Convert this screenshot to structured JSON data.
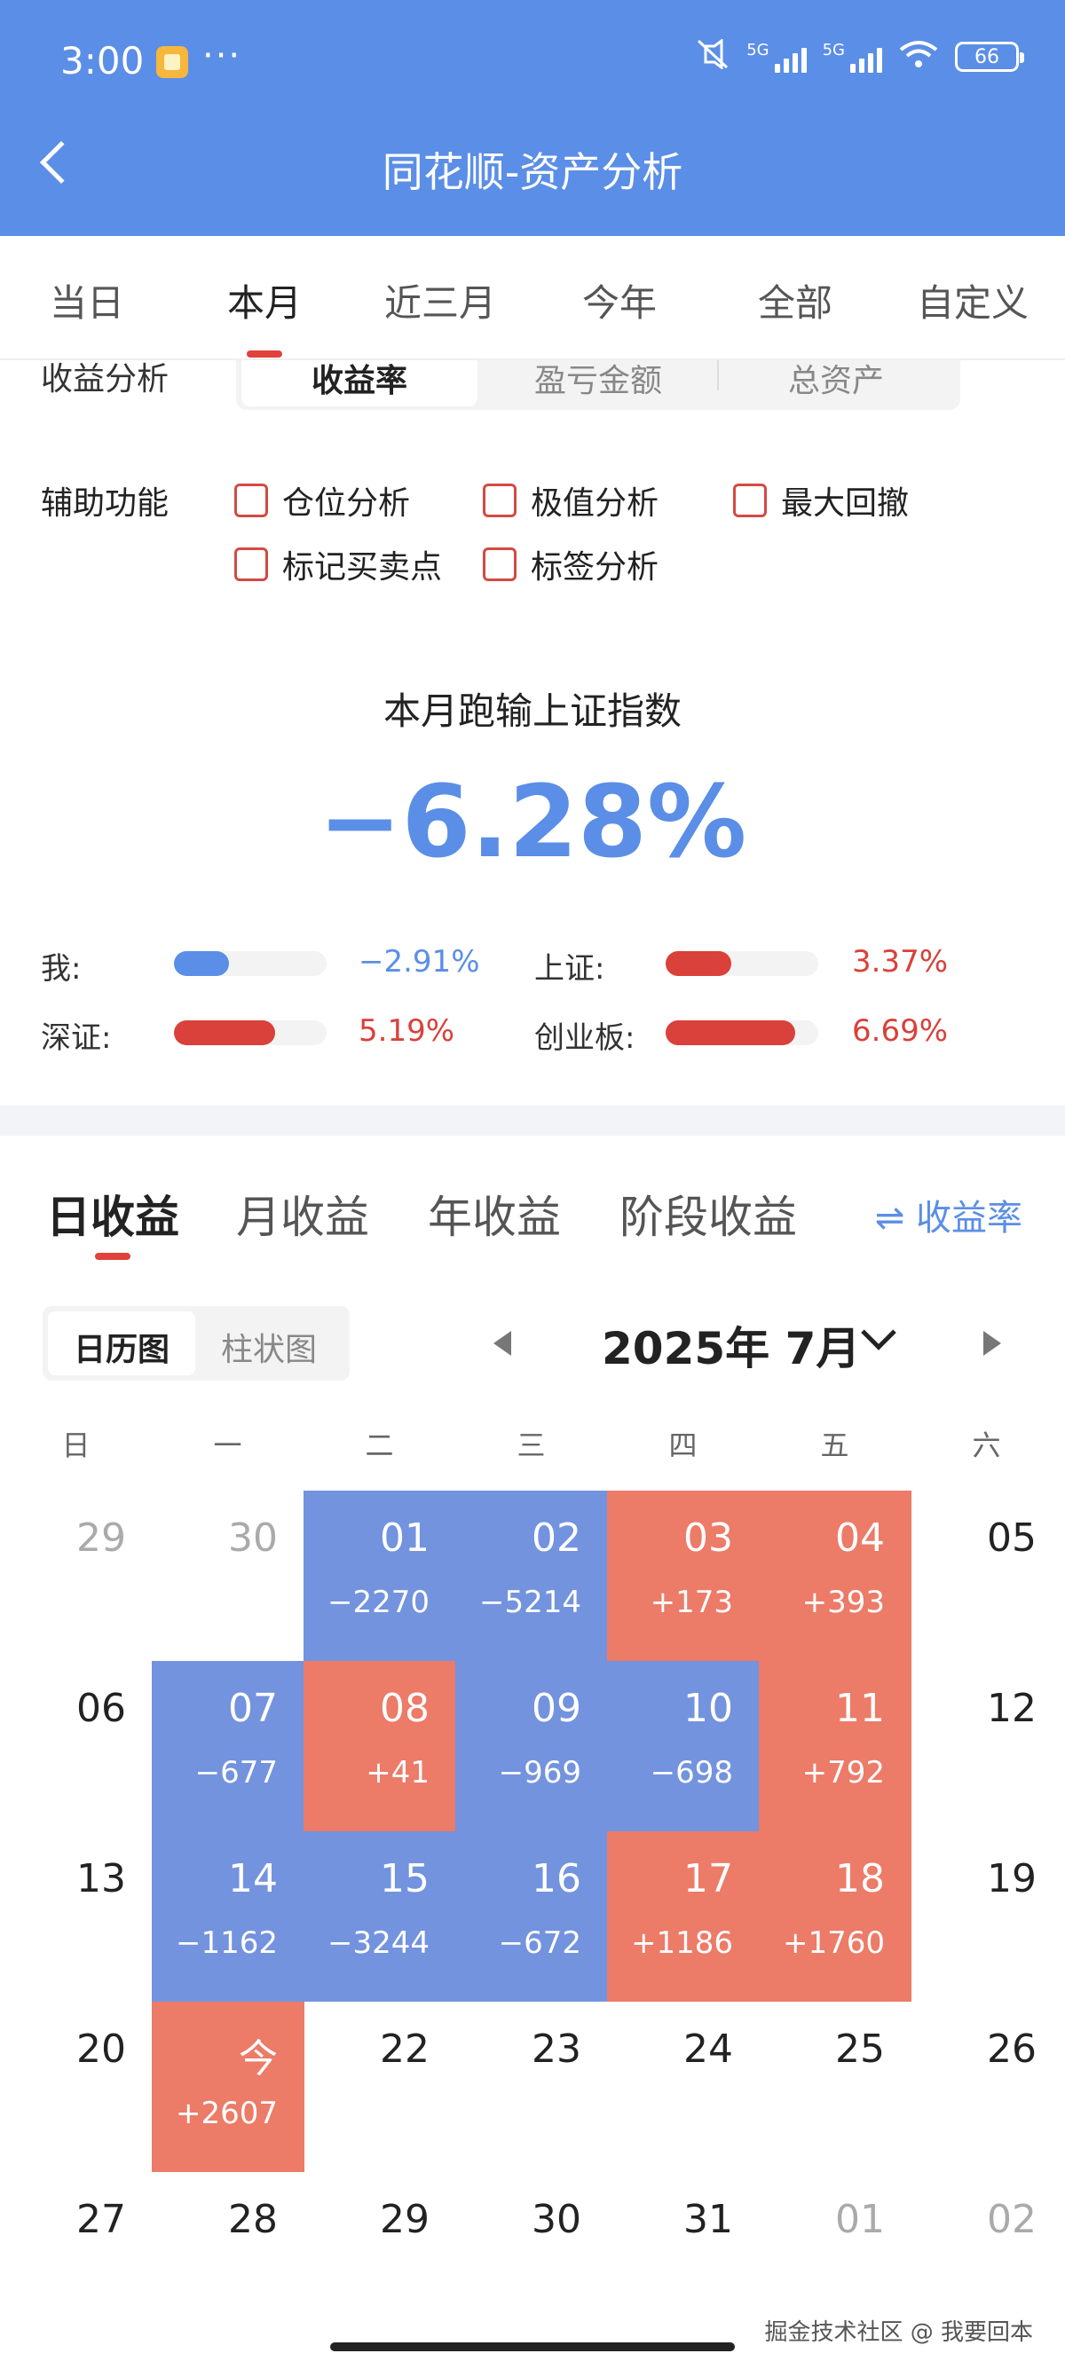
{
  "status_bar": {
    "time": "3:00",
    "more": "···",
    "net1": "5G",
    "net2": "5G",
    "battery": "66"
  },
  "header": {
    "title": "同花顺-资产分析"
  },
  "period_tabs": [
    "当日",
    "本月",
    "近三月",
    "今年",
    "全部",
    "自定义"
  ],
  "period_selected": 1,
  "analysis": {
    "label": "收益分析",
    "options": [
      "收益率",
      "盈亏金额",
      "总资产"
    ],
    "selected": 0
  },
  "aux": {
    "label": "辅助功能",
    "options": [
      "仓位分析",
      "极值分析",
      "最大回撤",
      "标记买卖点",
      "标签分析"
    ]
  },
  "summary": {
    "headline": "本月跑输上证指数",
    "value": "−6.28%"
  },
  "compare": [
    {
      "label": "我:",
      "value": "−2.91%",
      "fill": 0.36,
      "color": "#5b8ee6"
    },
    {
      "label": "上证:",
      "value": "3.37%",
      "fill": 0.43,
      "color": "#d9413a"
    },
    {
      "label": "深证:",
      "value": "5.19%",
      "fill": 0.66,
      "color": "#d9413a"
    },
    {
      "label": "创业板:",
      "value": "6.69%",
      "fill": 0.85,
      "color": "#d9413a"
    }
  ],
  "returns_tabs": [
    "日收益",
    "月收益",
    "年收益",
    "阶段收益"
  ],
  "returns_selected": 0,
  "rate_toggle": "⇌ 收益率",
  "view_switch": [
    "日历图",
    "柱状图"
  ],
  "view_selected": 0,
  "calendar": {
    "month_label": "2025年 7月",
    "weekdays": [
      "日",
      "一",
      "二",
      "三",
      "四",
      "五",
      "六"
    ],
    "weeks": [
      [
        {
          "d": "29",
          "t": "other"
        },
        {
          "d": "30",
          "t": "other"
        },
        {
          "d": "01",
          "p": "−2270",
          "t": "neg"
        },
        {
          "d": "02",
          "p": "−5214",
          "t": "neg"
        },
        {
          "d": "03",
          "p": "+173",
          "t": "pos"
        },
        {
          "d": "04",
          "p": "+393",
          "t": "pos"
        },
        {
          "d": "05",
          "t": "plain"
        }
      ],
      [
        {
          "d": "06",
          "t": "plain"
        },
        {
          "d": "07",
          "p": "−677",
          "t": "neg"
        },
        {
          "d": "08",
          "p": "+41",
          "t": "pos"
        },
        {
          "d": "09",
          "p": "−969",
          "t": "neg"
        },
        {
          "d": "10",
          "p": "−698",
          "t": "neg"
        },
        {
          "d": "11",
          "p": "+792",
          "t": "pos"
        },
        {
          "d": "12",
          "t": "plain"
        }
      ],
      [
        {
          "d": "13",
          "t": "plain"
        },
        {
          "d": "14",
          "p": "−1162",
          "t": "neg"
        },
        {
          "d": "15",
          "p": "−3244",
          "t": "neg"
        },
        {
          "d": "16",
          "p": "−672",
          "t": "neg"
        },
        {
          "d": "17",
          "p": "+1186",
          "t": "pos"
        },
        {
          "d": "18",
          "p": "+1760",
          "t": "pos"
        },
        {
          "d": "19",
          "t": "plain"
        }
      ],
      [
        {
          "d": "20",
          "t": "plain"
        },
        {
          "d": "今",
          "p": "+2607",
          "t": "pos"
        },
        {
          "d": "22",
          "t": "plain"
        },
        {
          "d": "23",
          "t": "plain"
        },
        {
          "d": "24",
          "t": "plain"
        },
        {
          "d": "25",
          "t": "plain"
        },
        {
          "d": "26",
          "t": "plain"
        }
      ],
      [
        {
          "d": "27",
          "t": "plain"
        },
        {
          "d": "28",
          "t": "plain"
        },
        {
          "d": "29",
          "t": "plain"
        },
        {
          "d": "30",
          "t": "plain"
        },
        {
          "d": "31",
          "t": "plain"
        },
        {
          "d": "01",
          "t": "other"
        },
        {
          "d": "02",
          "t": "other"
        }
      ]
    ]
  },
  "watermark": "掘金技术社区 @ 我要回本",
  "colors": {
    "header": "#5b8ee6",
    "accent_red": "#e0413a",
    "loss_cell": "#7393de",
    "gain_cell": "#ec7b68"
  }
}
